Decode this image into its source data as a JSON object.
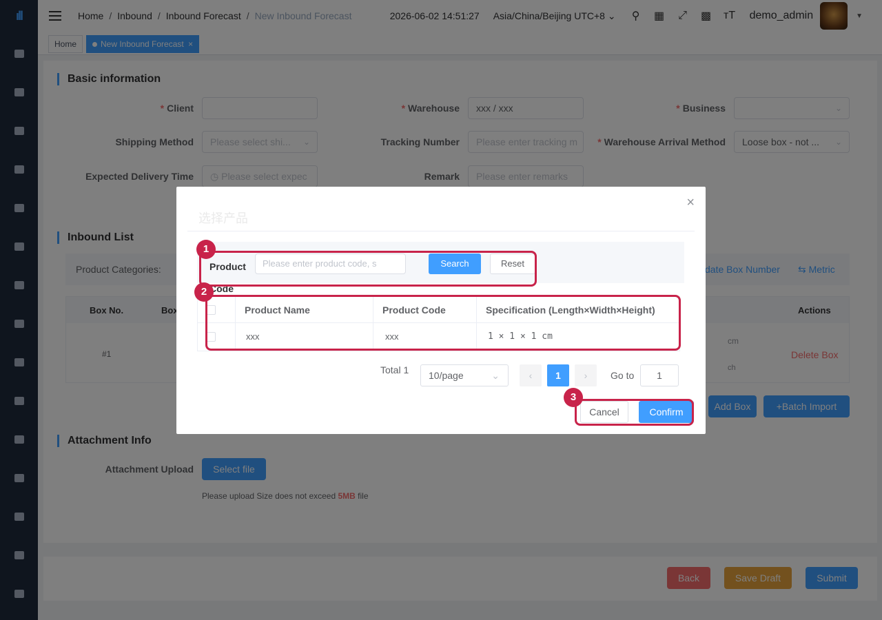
{
  "header": {
    "breadcrumb": [
      "Home",
      "Inbound",
      "Inbound Forecast",
      "New Inbound Forecast"
    ],
    "datetime": "2026-06-02 14:51:27",
    "timezone": "Asia/China/Beijing UTC+8",
    "username": "demo_admin",
    "icons": [
      "menu-toggle-icon",
      "search-icon",
      "message-icon",
      "fullscreen-icon",
      "translate-icon",
      "font-size-icon"
    ]
  },
  "tags": {
    "home": "Home",
    "active": "New Inbound Forecast",
    "close": "×"
  },
  "basic": {
    "title": "Basic information",
    "client_label": "Client",
    "warehouse_label": "Warehouse",
    "warehouse_value": "xxx / xxx",
    "business_label": "Business",
    "shipping_label": "Shipping Method",
    "shipping_placeholder": "Please select shi...",
    "tracking_label": "Tracking Number",
    "tracking_placeholder": "Please enter tracking m",
    "arrival_label": "Warehouse Arrival Method",
    "arrival_value": "Loose box - not ...",
    "delivery_label": "Expected Delivery Time",
    "delivery_placeholder": "Please select expec",
    "remark_label": "Remark",
    "remark_placeholder": "Please enter remarks"
  },
  "inbound": {
    "title": "Inbound List",
    "categories_label": "Product Categories:",
    "update_box": "date Box Number",
    "metric": "Metric",
    "col_box_no": "Box No.",
    "col_box": "Box",
    "col_actions": "Actions",
    "row_no": "#1",
    "unit_cm": "cm",
    "unit_inch": "ch",
    "delete_box": "Delete Box",
    "add_box": "Add Box",
    "batch_import": "+Batch Import"
  },
  "attachment": {
    "title": "Attachment Info",
    "upload_label": "Attachment Upload",
    "select_file": "Select file",
    "hint_pre": "Please upload Size does not exceed",
    "hint_size": "5MB",
    "hint_post": "file"
  },
  "footer": {
    "back": "Back",
    "save_draft": "Save Draft",
    "submit": "Submit"
  },
  "dialog": {
    "title": "选择产品",
    "search_label": "Product Code",
    "search_placeholder": "Please enter product code, s",
    "search_btn": "Search",
    "reset_btn": "Reset",
    "columns": [
      "Product Name",
      "Product Code",
      "Specification (Length×Width×Height)"
    ],
    "rows": [
      {
        "name": "xxx",
        "code": "xxx",
        "spec": "1 × 1 × 1 cm"
      }
    ],
    "total": "Total 1",
    "page_size": "10/page",
    "current_page": "1",
    "goto_label": "Go to",
    "goto_value": "1",
    "cancel": "Cancel",
    "confirm": "Confirm"
  },
  "annotations": [
    "1",
    "2",
    "3"
  ]
}
